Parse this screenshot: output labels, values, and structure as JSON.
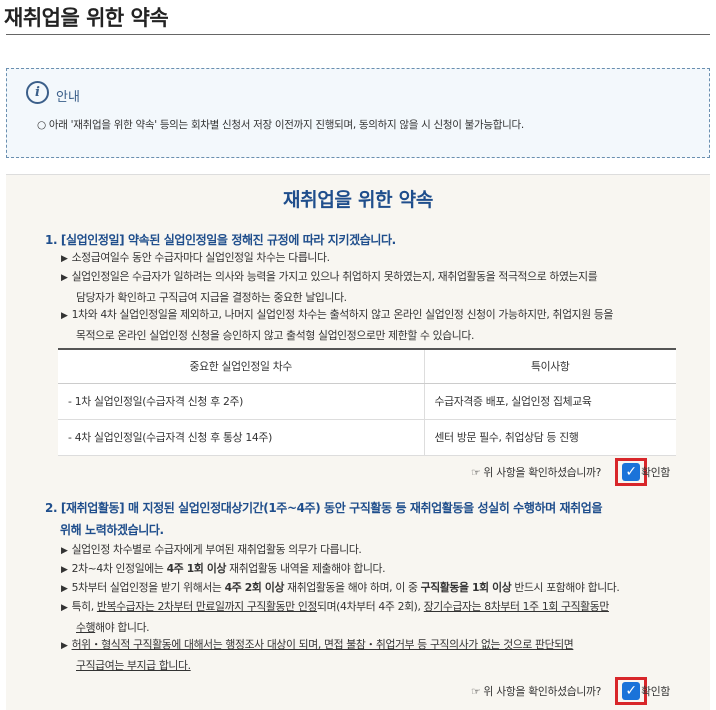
{
  "page": {
    "title": "재취업을 위한 약속"
  },
  "notice": {
    "icon": "info-icon",
    "heading": "안내",
    "text": "○ 아래 '재취업을 위한 약속' 등의는 회차별 신청서 저장 이전까지 진행되며, 동의하지 않을 시 신청이 불가능합니다."
  },
  "promise": {
    "title": "재취업을 위한 약속",
    "item1": {
      "heading": "1. [실업인정일] 약속된 실업인정일을 정해진 규정에 따라 지키겠습니다.",
      "b1": "소정급여일수 동안 수급자마다 실업인정일 차수는 다릅니다.",
      "b2_l1": "실업인정일은 수급자가 일하려는 의사와 능력을 가지고 있으나 취업하지 못하였는지, 재취업활동을 적극적으로 하였는지를",
      "b2_l2": "담당자가 확인하고 구직급여 지급을 결정하는 중요한 날입니다.",
      "b3_l1": "1차와 4차 실업인정일을 제외하고, 나머지 실업인정 차수는 출석하지 않고 온라인 실업인정 신청이 가능하지만, 취업지원 등을",
      "b3_l2": "목적으로 온라인 실업인정 신청을 승인하지 않고 출석형 실업인정으로만 제한할 수 있습니다.",
      "table": {
        "headers": [
          "중요한 실업인정일 차수",
          "특이사항"
        ],
        "rows": [
          [
            "- 1차 실업인정일(수급자격 신청 후 2주)",
            "수급자격증 배포, 실업인정 집체교육"
          ],
          [
            "- 4차 실업인정일(수급자격 신청 후 통상 14주)",
            "센터 방문 필수, 취업상담 등 진행"
          ]
        ]
      },
      "confirm_question": "☞ 위 사항을 확인하셨습니까?",
      "confirm_label": "확인함"
    },
    "item2": {
      "heading_l1": "2. [재취업활동] 매 지정된 실업인정대상기간(1주~4주) 동안 구직활동 등 재취업활동을 성실히 수행하며 재취업을",
      "heading_l2": "위해 노력하겠습니다.",
      "b1": "실업인정 차수별로 수급자에게 부여된 재취업활동 의무가 다릅니다.",
      "b2_pre": "2차~4차 인정일에는 ",
      "b2_bold": "4주 1회 이상",
      "b2_post": " 재취업활동 내역을 제출해야 합니다.",
      "b3_pre": "5차부터 실업인정을 받기 위해서는 ",
      "b3_bold1": "4주 2회 이상",
      "b3_mid": " 재취업활동을 해야 하며, 이 중 ",
      "b3_bold2": "구직활동을 1회 이상",
      "b3_post": " 반드시 포함해야 합니다.",
      "b4_pre": "특히, ",
      "b4_u1": "반복수급자는 2차부터 만료일까지 구직활동만 인정",
      "b4_mid": "되며(4차부터 4주 2회), ",
      "b4_u2": "장기수급자는 8차부터 1주 1회 구직활동만",
      "b4_l2": "수행",
      "b4_l2_post": "해야 합니다.",
      "b5_l1": "허위・형식적 구직활동에 대해서는 행정조사 대상이 되며, 면접 불참・취업거부 등 구직의사가 없는 것으로 판단되면",
      "b5_l2": "구직급여는 부지급 합니다.",
      "confirm_question": "☞ 위 사항을 확인하셨습니까?",
      "confirm_label": "확인함"
    }
  },
  "colors": {
    "accent": "#1f4e8c",
    "highlight_border": "#d8262a",
    "checkbox": "#1a73d9"
  }
}
